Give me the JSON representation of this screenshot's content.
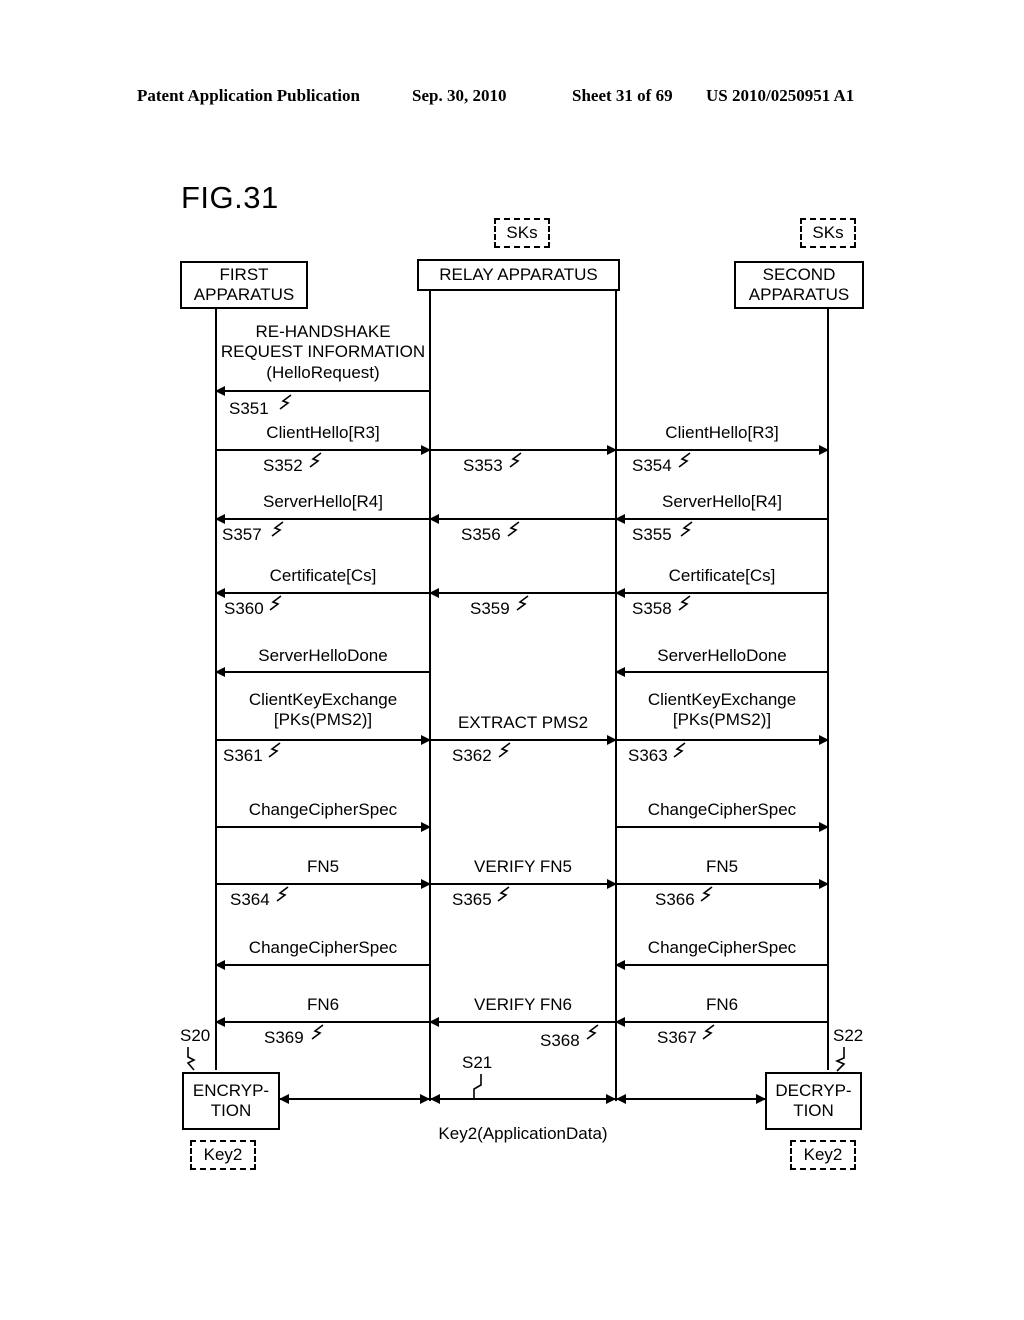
{
  "header": {
    "publication": "Patent Application Publication",
    "date": "Sep. 30, 2010",
    "sheet": "Sheet 31 of 69",
    "docnum": "US 2010/0250951 A1"
  },
  "figure": {
    "title": "FIG.31"
  },
  "actors": {
    "first": "FIRST\nAPPARATUS",
    "first_line1": "FIRST",
    "first_line2": "APPARATUS",
    "relay": "RELAY APPARATUS",
    "second_line1": "SECOND",
    "second_line2": "APPARATUS",
    "sks_relay": "SKs",
    "sks_second": "SKs"
  },
  "messages": {
    "hello_request_l1": "RE-HANDSHAKE",
    "hello_request_l2": "REQUEST INFORMATION",
    "hello_request_l3": "(HelloRequest)",
    "client_hello_left": "ClientHello[R3]",
    "client_hello_right": "ClientHello[R3]",
    "server_hello_left": "ServerHello[R4]",
    "server_hello_right": "ServerHello[R4]",
    "certificate_left": "Certificate[Cs]",
    "certificate_right": "Certificate[Cs]",
    "server_hello_done_left": "ServerHelloDone",
    "server_hello_done_right": "ServerHelloDone",
    "cke_left_l1": "ClientKeyExchange",
    "cke_left_l2": "[PKs(PMS2)]",
    "cke_mid": "EXTRACT PMS2",
    "cke_right_l1": "ClientKeyExchange",
    "cke_right_l2": "[PKs(PMS2)]",
    "ccs1_left": "ChangeCipherSpec",
    "ccs1_right": "ChangeCipherSpec",
    "fn5_left": "FN5",
    "fn5_mid": "VERIFY FN5",
    "fn5_right": "FN5",
    "ccs2_left": "ChangeCipherSpec",
    "ccs2_right": "ChangeCipherSpec",
    "fn6_left": "FN6",
    "fn6_mid": "VERIFY FN6",
    "fn6_right": "FN6",
    "app_data": "Key2(ApplicationData)"
  },
  "steps": {
    "s351": "S351",
    "s352": "S352",
    "s353": "S353",
    "s354": "S354",
    "s355": "S355",
    "s356": "S356",
    "s357": "S357",
    "s358": "S358",
    "s359": "S359",
    "s360": "S360",
    "s361": "S361",
    "s362": "S362",
    "s363": "S363",
    "s364": "S364",
    "s365": "S365",
    "s366": "S366",
    "s367": "S367",
    "s368": "S368",
    "s369": "S369",
    "s20": "S20",
    "s21": "S21",
    "s22": "S22"
  },
  "bottom": {
    "encryption_l1": "ENCRYP-",
    "encryption_l2": "TION",
    "decryption_l1": "DECRYP-",
    "decryption_l2": "TION",
    "key2_left": "Key2",
    "key2_right": "Key2"
  },
  "colors": {
    "ink": "#000000",
    "paper": "#ffffff"
  }
}
